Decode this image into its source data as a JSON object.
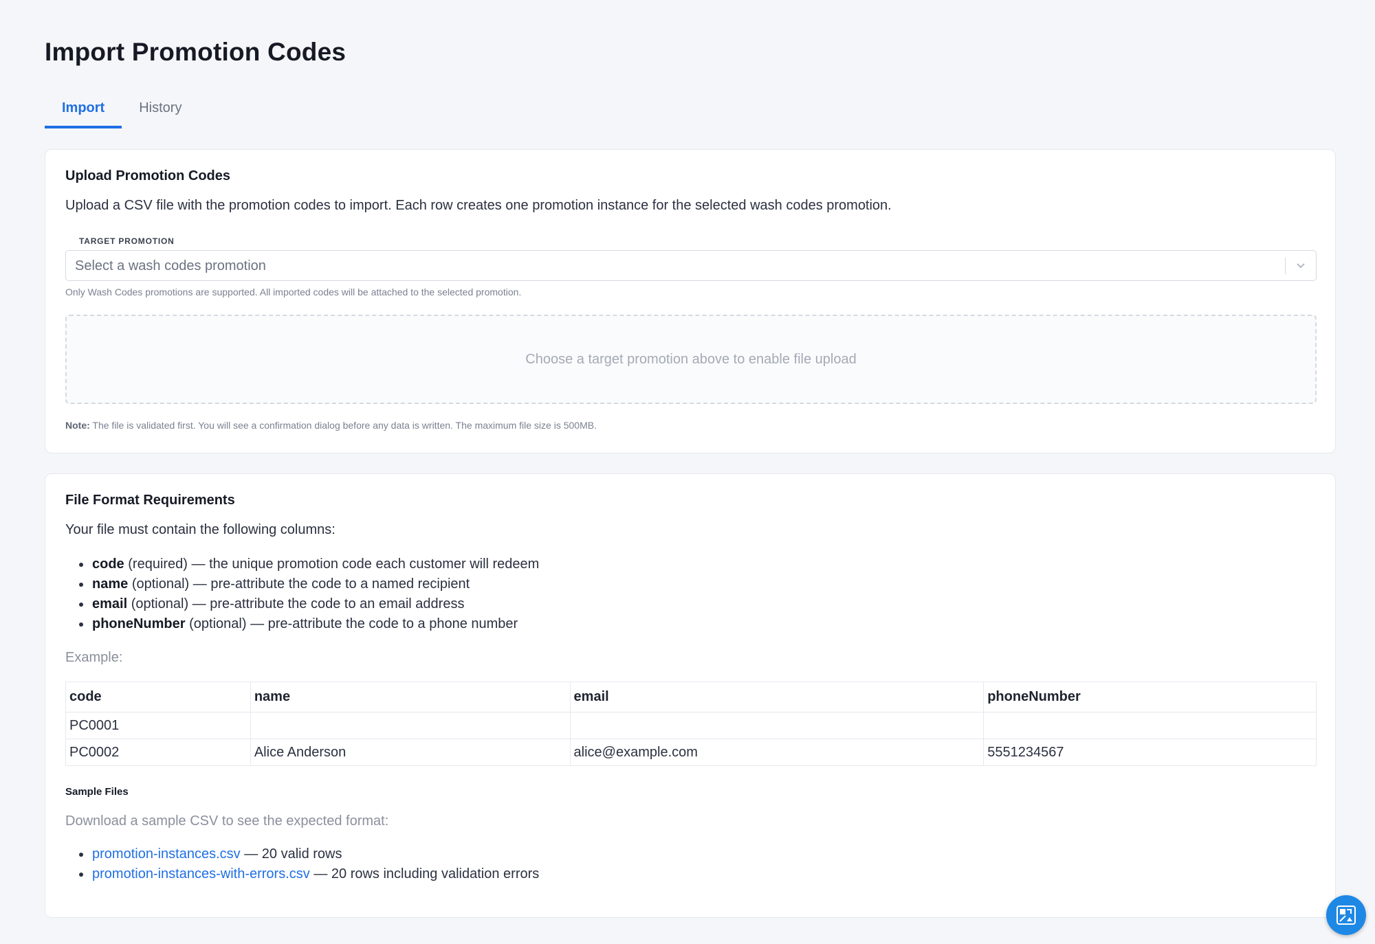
{
  "page": {
    "title": "Import Promotion Codes"
  },
  "tabs": [
    {
      "label": "Import",
      "active": true
    },
    {
      "label": "History",
      "active": false
    }
  ],
  "upload": {
    "title": "Upload Promotion Codes",
    "description": "Upload a CSV file with the promotion codes to import. Each row creates one promotion instance for the selected wash codes promotion.",
    "target_label": "TARGET PROMOTION",
    "select_placeholder": "Select a wash codes promotion",
    "select_hint": "Only Wash Codes promotions are supported. All imported codes will be attached to the selected promotion.",
    "dropzone_text": "Choose a target promotion above to enable file upload",
    "note_label": "Note:",
    "note_text": "The file is validated first. You will see a confirmation dialog before any data is written. The maximum file size is 500MB."
  },
  "format": {
    "title": "File Format Requirements",
    "intro": "Your file must contain the following columns:",
    "columns": [
      {
        "name": "code",
        "requirement": "(required)",
        "description": "— the unique promotion code each customer will redeem"
      },
      {
        "name": "name",
        "requirement": "(optional)",
        "description": "— pre-attribute the code to a named recipient"
      },
      {
        "name": "email",
        "requirement": "(optional)",
        "description": "— pre-attribute the code to an email address"
      },
      {
        "name": "phoneNumber",
        "requirement": "(optional)",
        "description": "— pre-attribute the code to a phone number"
      }
    ],
    "example_label": "Example:",
    "table": {
      "headers": [
        "code",
        "name",
        "email",
        "phoneNumber"
      ],
      "rows": [
        [
          "PC0001",
          "",
          "",
          ""
        ],
        [
          "PC0002",
          "Alice Anderson",
          "alice@example.com",
          "5551234567"
        ]
      ]
    },
    "samples_title": "Sample Files",
    "samples_intro": "Download a sample CSV to see the expected format:",
    "samples": [
      {
        "file": "promotion-instances.csv",
        "description": "— 20 valid rows"
      },
      {
        "file": "promotion-instances-with-errors.csv",
        "description": "— 20 rows including validation errors"
      }
    ]
  },
  "fab": {
    "icon": "help-widget-icon"
  },
  "colors": {
    "accent": "#1f6fe5",
    "background": "#f5f6f9",
    "fab": "#1e88e5"
  }
}
